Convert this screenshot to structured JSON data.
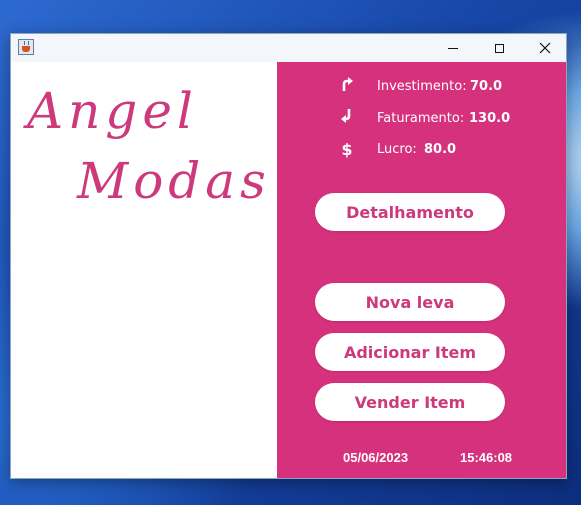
{
  "window": {
    "title": ""
  },
  "logo": {
    "line1": "Angel",
    "line2": "Modas"
  },
  "stats": {
    "investimento": {
      "icon": "arrow-turn-up-right-icon",
      "label": "Investimento:",
      "value": "70.0"
    },
    "faturamento": {
      "icon": "arrow-turn-down-left-icon",
      "label": "Faturamento:",
      "value": "130.0"
    },
    "lucro": {
      "icon": "dollar-icon",
      "label": "Lucro:",
      "value": "80.0"
    }
  },
  "buttons": {
    "detalhamento": "Detalhamento",
    "nova_leva": "Nova leva",
    "adicionar_item": "Adicionar Item",
    "vender_item": "Vender Item"
  },
  "footer": {
    "date": "05/06/2023",
    "time": "15:46:08"
  },
  "colors": {
    "accent": "#d6317c",
    "logo": "#cc3a7c",
    "button_text": "#cc3a7c"
  }
}
